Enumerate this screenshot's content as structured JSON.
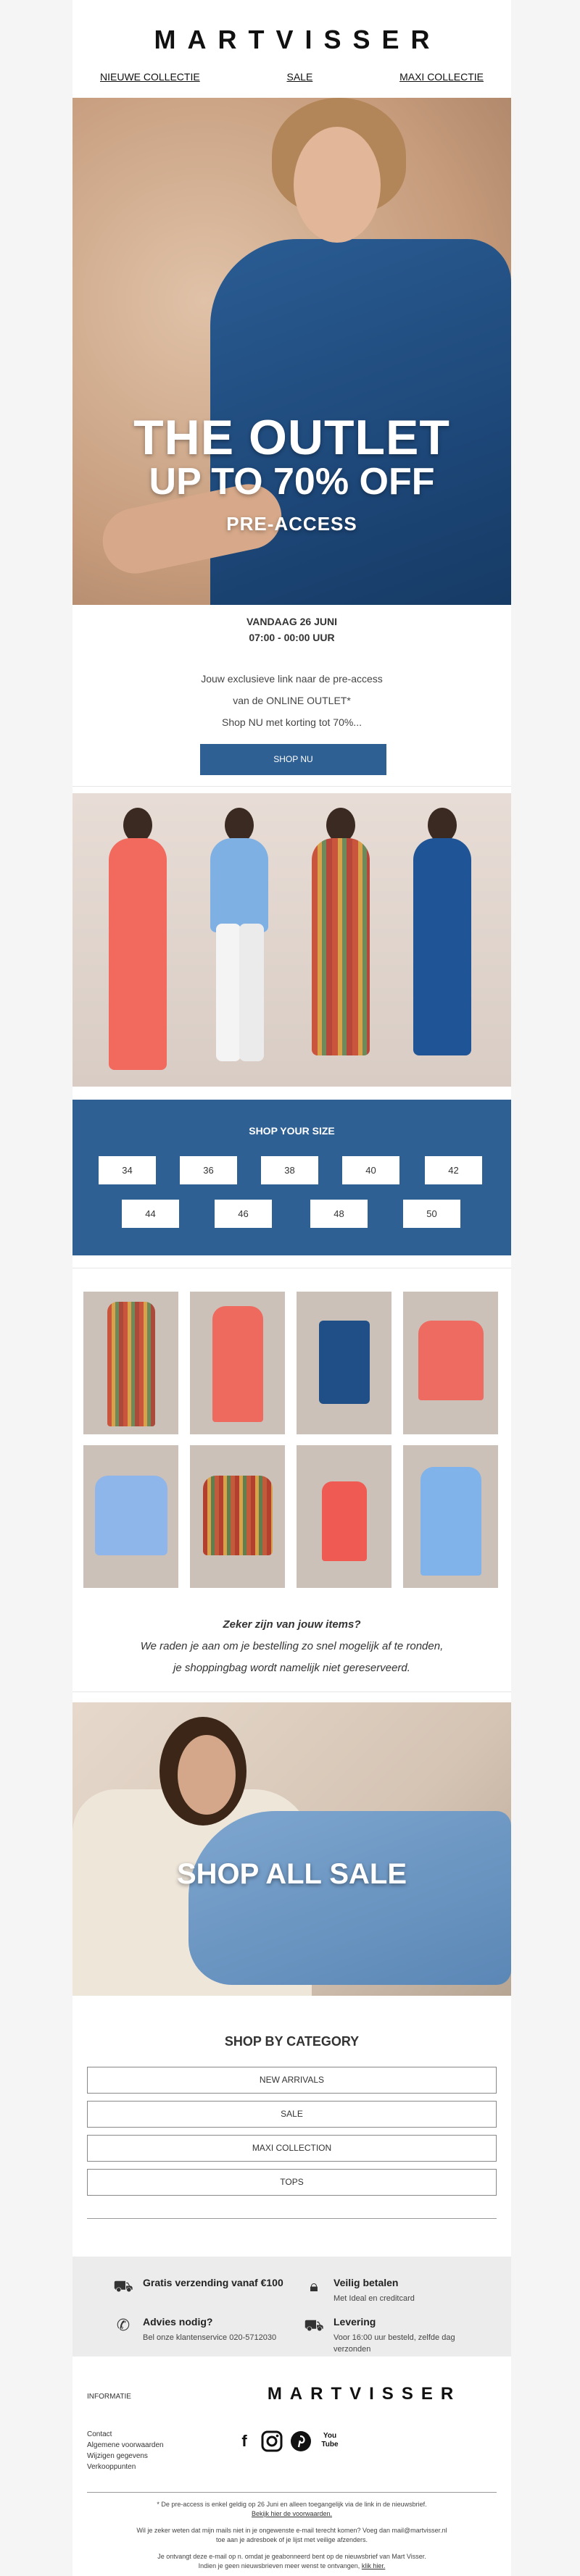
{
  "header": {
    "brand": "MARTVISSER",
    "nav": [
      "NIEUWE COLLECTIE",
      "SALE",
      "MAXI COLLECTIE"
    ]
  },
  "hero": {
    "title": "THE OUTLET",
    "subtitle": "UP TO 70% OFF",
    "tag": "PRE-ACCESS"
  },
  "event": {
    "date": "VANDAAG 26 JUNI",
    "time": "07:00 - 00:00 UUR",
    "lines": [
      "Jouw exclusieve link naar de pre-access",
      "van de ONLINE OUTLET*",
      "Shop NU met korting tot 70%..."
    ],
    "button": "SHOP NU"
  },
  "sizes": {
    "title": "SHOP YOUR SIZE",
    "row1": [
      "34",
      "36",
      "38",
      "40",
      "42"
    ],
    "row2": [
      "44",
      "46",
      "48",
      "50"
    ]
  },
  "prompt": {
    "question": "Zeker zijn van jouw items?",
    "line1": "We raden je aan om je bestelling zo snel mogelijk af te ronden,",
    "line2": "je shoppingbag wordt namelijk niet gereserveerd."
  },
  "sale_banner": {
    "label": "SHOP ALL SALE"
  },
  "categories": {
    "title": "SHOP BY CATEGORY",
    "items": [
      "NEW ARRIVALS",
      "SALE",
      "MAXI COLLECTION",
      "TOPS"
    ]
  },
  "usps": [
    {
      "icon": "truck-icon",
      "title": "Gratis verzending vanaf €100",
      "sub": ""
    },
    {
      "icon": "lock-icon",
      "title": "Veilig betalen",
      "sub": "Met Ideal en creditcard"
    },
    {
      "icon": "phone-icon",
      "title": "Advies nodig?",
      "sub": "Bel onze klantenservice 020-5712030"
    },
    {
      "icon": "delivery-icon",
      "title": "Levering",
      "sub": "Voor 16:00 uur besteld, zelfde dag verzonden"
    }
  ],
  "footer": {
    "label": "INFORMATIE",
    "brand": "MARTVISSER",
    "links": [
      "Contact",
      "Algemene voorwaarden",
      "Wijzigen gegevens",
      "Verkooppunten"
    ],
    "social": [
      "facebook-icon",
      "instagram-icon",
      "pinterest-icon",
      "youtube-icon"
    ],
    "social_glyphs": {
      "facebook": "f",
      "youtube": "You Tube"
    },
    "legal1": "* De pre-access is enkel geldig op 26 Juni en alleen toegangelijk via de link in de nieuwsbrief.",
    "legal1_link": "Bekijk hier de voorwaarden.",
    "legal2": "Wil je zeker weten dat mijn mails niet in je ongewenste e-mail terecht komen? Voeg dan mail@martvisser.nl",
    "legal3": "toe aan je adresboek of je lijst met veilige afzenders.",
    "legal4": "Je ontvangt deze e-mail op n. omdat je geabonneerd bent op de nieuwsbrief van Mart Visser.",
    "legal5": "Indien je geen nieuwsbrieven meer wenst te ontvangen,",
    "legal5_link": "klik hier."
  },
  "colors": {
    "brand_blue": "#2e6093",
    "background": "#f5f5f5",
    "usp_bar": "#ececec"
  }
}
